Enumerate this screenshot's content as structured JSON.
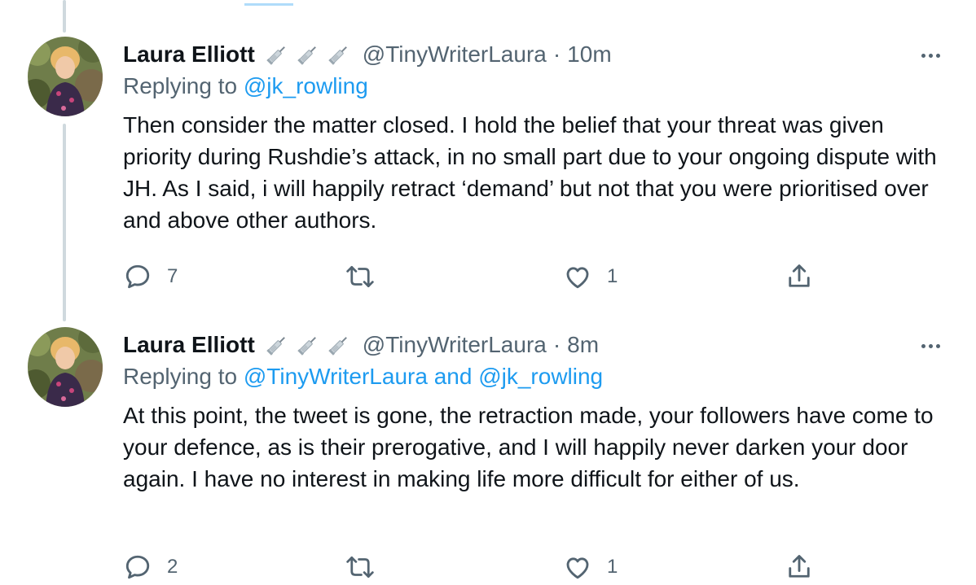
{
  "tweets": [
    {
      "name": "Laura Elliott",
      "handle": "@TinyWriterLaura",
      "dot": "·",
      "time": "10m",
      "replying_prefix": "Replying to ",
      "replying_mentions": [
        "@jk_rowling"
      ],
      "replying_joiner": "",
      "text": "Then consider the matter closed. I hold the belief that your threat was given priority during Rushdie’s attack, in no small part due to your ongoing dispute with JH. As I said, i will happily retract ‘demand’ but not that you were prioritised over and above other authors.",
      "reply_count": "7",
      "retweet_count": "",
      "like_count": "1",
      "name_emoji_icons": [
        "syringe-icon",
        "syringe-icon",
        "syringe-icon"
      ]
    },
    {
      "name": "Laura Elliott",
      "handle": "@TinyWriterLaura",
      "dot": "·",
      "time": "8m",
      "replying_prefix": "Replying to ",
      "replying_mentions": [
        "@TinyWriterLaura",
        "@jk_rowling"
      ],
      "replying_joiner": " and ",
      "text": "At this point, the tweet is gone, the retraction made, your followers have come to your defence, as is their prerogative, and I will happily never darken your door again. I have no interest in making life more difficult for either of us.",
      "reply_count": "2",
      "retweet_count": "",
      "like_count": "1",
      "name_emoji_icons": [
        "syringe-icon",
        "syringe-icon",
        "syringe-icon"
      ]
    }
  ],
  "colors": {
    "text": "#0f1419",
    "secondary": "#536471",
    "link": "#1d9bf0",
    "thread_line": "#cfd9de"
  },
  "icons": {
    "reply": "reply-icon",
    "retweet": "retweet-icon",
    "like": "like-icon",
    "share": "share-icon",
    "more": "more-icon"
  }
}
